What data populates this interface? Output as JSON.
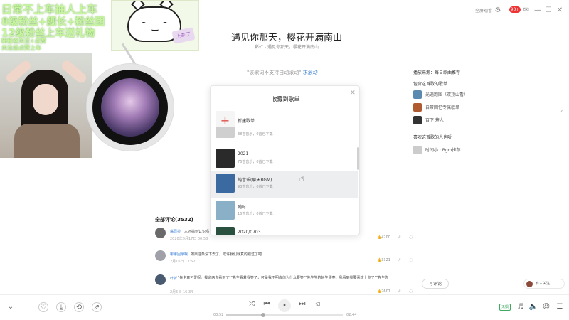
{
  "window": {
    "account_label": "全屏观看",
    "vip_badge": "90+",
    "close": "✕",
    "maximize": "☐",
    "minimize": "—",
    "restore": "⧉",
    "settings": "⚙",
    "mail": "✉"
  },
  "overlay": {
    "line1": "日常不上车抽人上车",
    "line2": "8级粉丝+舰长+粉丝团",
    "line3": "12级粉丝上车送礼物",
    "line4": "新粉丝关注+点赞",
    "line5": "关注后点赞上车",
    "sticker_sign": "上车了"
  },
  "song": {
    "title": "遇见你那天，樱花开满南山",
    "subtitle": "彩虹 - 遇见你那天，樱花开满南山",
    "lyric_note": "\"该歌词不支持自动滚动\"",
    "lyric_link": "求滚动"
  },
  "right_panel": {
    "source_heading": "播放来源：每日歌曲推荐",
    "playlists_heading": "包含这首歌的歌单",
    "playlists": [
      {
        "name": "光遇跑图（双顶山看）",
        "color": "#5a8ab0"
      },
      {
        "name": "自带回忆专属歌单",
        "color": "#b05a30"
      },
      {
        "name": "百下 筹人",
        "color": "#333333"
      }
    ],
    "listeners_heading": "喜欢这首歌的人也听",
    "listeners": [
      {
        "name": "时间小 · Bgm推荐",
        "color": "#cccccc"
      }
    ],
    "more_arrow": "›"
  },
  "dialog": {
    "title": "收藏到歌单",
    "close": "✕",
    "new_playlist_label": "新建歌单",
    "rows": [
      {
        "name": "",
        "meta": "38首音乐，0首已下载",
        "color": "#cfcfcf"
      },
      {
        "name": "2021",
        "meta": "76首音乐，0首已下载",
        "color": "#2a2a2a"
      },
      {
        "name": "纯音乐(聊天BGM)",
        "meta": "93首音乐，0首已下载",
        "color": "#3a6aa0"
      },
      {
        "name": "随时",
        "meta": "16首音乐，0首已下载",
        "color": "#8ab0c8"
      },
      {
        "name": "2020/0703",
        "meta": "",
        "color": "#2a5040"
      }
    ]
  },
  "comments": {
    "heading": "全部评论(3532)",
    "items": [
      {
        "user": "嘴唇抄",
        "text": "人还搞到认识吗",
        "time": "2020年9月17日 00:58",
        "likes": "4200",
        "avatar": "#6a6a6a"
      },
      {
        "user": "哪哪回家啊",
        "text": "如果这条没下去了，或许我们就真的错过了吧",
        "time": "2月16日 17:52",
        "likes": "3321",
        "avatar": "#a0a0a8"
      },
      {
        "user": "叶折",
        "text": "\"先生真可爱呢。我道两你看到了\"\"先生看着我笑了，可是我不明白你为什么要笑\"\"先生生的好生漂亮，我看到我要喜欢上你了\"\"先生你",
        "time": "2月5日 16:34",
        "likes": "2607",
        "avatar": "#4a5a70"
      }
    ],
    "write_label": "写评论",
    "followers_label": "有人关注..."
  },
  "player": {
    "current_time": "00:52",
    "total_time": "02:44",
    "progress": 0.32,
    "quality": "无损",
    "lyric_btn": "词",
    "down": "⌄",
    "like": "♡",
    "download": "⤓",
    "comment": "⟲",
    "share": "⇗",
    "shuffle": "⤮",
    "prev": "⏮",
    "play": "⏸",
    "next": "⏭"
  }
}
